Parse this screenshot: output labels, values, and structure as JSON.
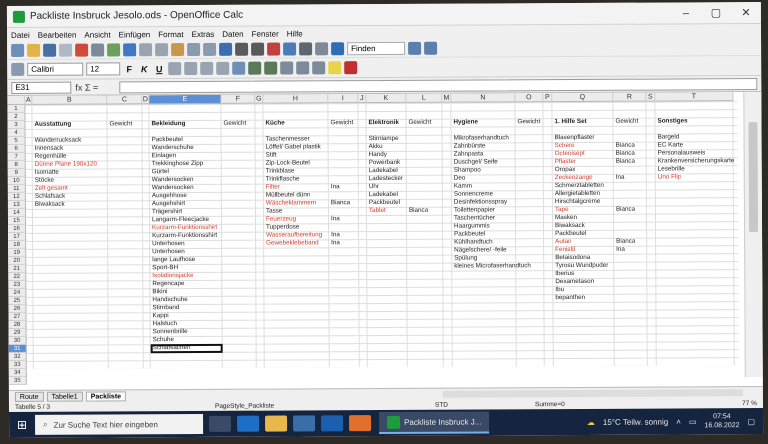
{
  "window": {
    "title": "Packliste Insbruck Jesolo.ods - OpenOffice Calc"
  },
  "menu": [
    "Datei",
    "Bearbeiten",
    "Ansicht",
    "Einfügen",
    "Format",
    "Extras",
    "Daten",
    "Fenster",
    "Hilfe"
  ],
  "toolbar": {
    "find_placeholder": "Finden"
  },
  "format": {
    "font": "Calibri",
    "size": "12"
  },
  "formula": {
    "cell_ref": "E31",
    "fx": "fx Σ ="
  },
  "columns": [
    "A",
    "B",
    "C",
    "D",
    "E",
    "F",
    "G",
    "H",
    "I",
    "J",
    "K",
    "L",
    "M",
    "N",
    "O",
    "P",
    "Q",
    "R",
    "S",
    "T"
  ],
  "selected_column": "E",
  "rows_count": 35,
  "selected_row": 31,
  "cells": [
    {
      "r": 3,
      "c": "B",
      "t": "Ausstattung",
      "b": true
    },
    {
      "r": 3,
      "c": "C",
      "t": "Gewicht"
    },
    {
      "r": 3,
      "c": "E",
      "t": "Bekleidung",
      "b": true
    },
    {
      "r": 3,
      "c": "F",
      "t": "Gewicht"
    },
    {
      "r": 3,
      "c": "H",
      "t": "Küche",
      "b": true
    },
    {
      "r": 3,
      "c": "I",
      "t": "Gewicht"
    },
    {
      "r": 3,
      "c": "K",
      "t": "Elektronik",
      "b": true
    },
    {
      "r": 3,
      "c": "L",
      "t": "Gewicht"
    },
    {
      "r": 3,
      "c": "N",
      "t": "Hygiene",
      "b": true
    },
    {
      "r": 3,
      "c": "O",
      "t": "Gewicht"
    },
    {
      "r": 3,
      "c": "Q",
      "t": "1. Hilfe Set",
      "b": true
    },
    {
      "r": 3,
      "c": "R",
      "t": "Gewicht"
    },
    {
      "r": 3,
      "c": "T",
      "t": "Sonstiges",
      "b": true
    },
    {
      "r": 5,
      "c": "B",
      "t": "Wanderrucksack"
    },
    {
      "r": 6,
      "c": "B",
      "t": "Innensack"
    },
    {
      "r": 7,
      "c": "B",
      "t": "Regenhülle"
    },
    {
      "r": 8,
      "c": "B",
      "t": "Dünne Plane 190x120",
      "red": true
    },
    {
      "r": 9,
      "c": "B",
      "t": "Isomatte"
    },
    {
      "r": 10,
      "c": "B",
      "t": "Stöcke"
    },
    {
      "r": 11,
      "c": "B",
      "t": "Zelt gesamt",
      "red": true
    },
    {
      "r": 12,
      "c": "B",
      "t": "Schlafsack"
    },
    {
      "r": 13,
      "c": "B",
      "t": "Biwaksack"
    },
    {
      "r": 5,
      "c": "E",
      "t": "Packbeutel"
    },
    {
      "r": 6,
      "c": "E",
      "t": "Wanderschuhe"
    },
    {
      "r": 7,
      "c": "E",
      "t": "Einlagen"
    },
    {
      "r": 8,
      "c": "E",
      "t": "Trekkinghose Zipp"
    },
    {
      "r": 9,
      "c": "E",
      "t": "Gürtel"
    },
    {
      "r": 10,
      "c": "E",
      "t": "Wandersocken"
    },
    {
      "r": 11,
      "c": "E",
      "t": "Wandersocken"
    },
    {
      "r": 12,
      "c": "E",
      "t": "Ausgehhose"
    },
    {
      "r": 13,
      "c": "E",
      "t": "Ausgehshirt"
    },
    {
      "r": 14,
      "c": "E",
      "t": "Trägershirt"
    },
    {
      "r": 15,
      "c": "E",
      "t": "Langarm-Fleecjacke"
    },
    {
      "r": 16,
      "c": "E",
      "t": "Kurzarm-Funktionsshirt",
      "red": true
    },
    {
      "r": 17,
      "c": "E",
      "t": "Kurzarm-Funktionsshirt"
    },
    {
      "r": 18,
      "c": "E",
      "t": "Unterhosen"
    },
    {
      "r": 19,
      "c": "E",
      "t": "Unterhosen"
    },
    {
      "r": 20,
      "c": "E",
      "t": "lange Laufhose"
    },
    {
      "r": 21,
      "c": "E",
      "t": "Sport-BH"
    },
    {
      "r": 22,
      "c": "E",
      "t": "Isolationsjacke",
      "red": true
    },
    {
      "r": 23,
      "c": "E",
      "t": "Regencape"
    },
    {
      "r": 24,
      "c": "E",
      "t": "Bikini"
    },
    {
      "r": 25,
      "c": "E",
      "t": "Handschuhe"
    },
    {
      "r": 26,
      "c": "E",
      "t": "Stirnband"
    },
    {
      "r": 27,
      "c": "E",
      "t": "Kappi"
    },
    {
      "r": 28,
      "c": "E",
      "t": "Halstuch"
    },
    {
      "r": 29,
      "c": "E",
      "t": "Sonnenbrille"
    },
    {
      "r": 30,
      "c": "E",
      "t": "Schuhe"
    },
    {
      "r": 31,
      "c": "E",
      "t": "Schlafsachen"
    },
    {
      "r": 5,
      "c": "H",
      "t": "Taschenmesser"
    },
    {
      "r": 6,
      "c": "H",
      "t": "Löffel/ Gabel plastik"
    },
    {
      "r": 7,
      "c": "H",
      "t": "Stift"
    },
    {
      "r": 8,
      "c": "H",
      "t": "Zip-Lock-Beutel"
    },
    {
      "r": 9,
      "c": "H",
      "t": "Trinkblase"
    },
    {
      "r": 10,
      "c": "H",
      "t": "Trinkflasche"
    },
    {
      "r": 11,
      "c": "H",
      "t": "Filter",
      "red": true
    },
    {
      "r": 11,
      "c": "I",
      "t": "Ina"
    },
    {
      "r": 12,
      "c": "H",
      "t": "Müllbeutel dünn"
    },
    {
      "r": 13,
      "c": "H",
      "t": "Wäscheklammern",
      "red": true
    },
    {
      "r": 13,
      "c": "I",
      "t": "Bianca"
    },
    {
      "r": 14,
      "c": "H",
      "t": "Tasse"
    },
    {
      "r": 15,
      "c": "H",
      "t": "Feuerzeug",
      "red": true
    },
    {
      "r": 15,
      "c": "I",
      "t": "Ina"
    },
    {
      "r": 16,
      "c": "H",
      "t": "Tupperdose"
    },
    {
      "r": 17,
      "c": "H",
      "t": "Wasseraufbereitung",
      "red": true
    },
    {
      "r": 17,
      "c": "I",
      "t": "Ina"
    },
    {
      "r": 18,
      "c": "H",
      "t": "Gewebeklebeband",
      "red": true
    },
    {
      "r": 18,
      "c": "I",
      "t": "Ina"
    },
    {
      "r": 5,
      "c": "K",
      "t": "Stirnlampe"
    },
    {
      "r": 6,
      "c": "K",
      "t": "Akku"
    },
    {
      "r": 7,
      "c": "K",
      "t": "Handy"
    },
    {
      "r": 8,
      "c": "K",
      "t": "Powerbank"
    },
    {
      "r": 9,
      "c": "K",
      "t": "Ladekabel"
    },
    {
      "r": 10,
      "c": "K",
      "t": "Ladestecker"
    },
    {
      "r": 11,
      "c": "K",
      "t": "Uhr"
    },
    {
      "r": 12,
      "c": "K",
      "t": "Ladekabel"
    },
    {
      "r": 13,
      "c": "K",
      "t": "Packbeutel"
    },
    {
      "r": 14,
      "c": "K",
      "t": "Tablet",
      "red": true
    },
    {
      "r": 14,
      "c": "L",
      "t": "Bianca"
    },
    {
      "r": 5,
      "c": "N",
      "t": "Mikrofaserhandtuch"
    },
    {
      "r": 6,
      "c": "N",
      "t": "Zahnbürste"
    },
    {
      "r": 7,
      "c": "N",
      "t": "Zahnpasta"
    },
    {
      "r": 8,
      "c": "N",
      "t": "Duschgel/ Seife"
    },
    {
      "r": 9,
      "c": "N",
      "t": "Shampoo"
    },
    {
      "r": 10,
      "c": "N",
      "t": "Deo"
    },
    {
      "r": 11,
      "c": "N",
      "t": "Kamm"
    },
    {
      "r": 12,
      "c": "N",
      "t": "Sonnencreme"
    },
    {
      "r": 13,
      "c": "N",
      "t": "Desinfektionsspray"
    },
    {
      "r": 14,
      "c": "N",
      "t": "Toilettenpapier"
    },
    {
      "r": 15,
      "c": "N",
      "t": "Taschentücher"
    },
    {
      "r": 16,
      "c": "N",
      "t": "Haargummis"
    },
    {
      "r": 17,
      "c": "N",
      "t": "Packbeutel"
    },
    {
      "r": 18,
      "c": "N",
      "t": "Kühlhandtuch"
    },
    {
      "r": 19,
      "c": "N",
      "t": "Nägelschere/ -feile"
    },
    {
      "r": 20,
      "c": "N",
      "t": "Spülung"
    },
    {
      "r": 21,
      "c": "N",
      "t": "kleines Microfaserhandtuch"
    },
    {
      "r": 5,
      "c": "Q",
      "t": "Blasenpflaster"
    },
    {
      "r": 6,
      "c": "Q",
      "t": "Schere",
      "red": true
    },
    {
      "r": 6,
      "c": "R",
      "t": "Bianca"
    },
    {
      "r": 7,
      "c": "Q",
      "t": "Octenisept",
      "red": true
    },
    {
      "r": 7,
      "c": "R",
      "t": "Bianca"
    },
    {
      "r": 8,
      "c": "Q",
      "t": "Pflaster",
      "red": true
    },
    {
      "r": 8,
      "c": "R",
      "t": "Bianca"
    },
    {
      "r": 9,
      "c": "Q",
      "t": "Oropax"
    },
    {
      "r": 10,
      "c": "Q",
      "t": "Zeckenzange",
      "red": true
    },
    {
      "r": 10,
      "c": "R",
      "t": "Ina"
    },
    {
      "r": 11,
      "c": "Q",
      "t": "Schmerztabletten"
    },
    {
      "r": 12,
      "c": "Q",
      "t": "Allergietabletten"
    },
    {
      "r": 13,
      "c": "Q",
      "t": "Hirschtalgcreme"
    },
    {
      "r": 14,
      "c": "Q",
      "t": "Tape",
      "red": true
    },
    {
      "r": 14,
      "c": "R",
      "t": "Bianca"
    },
    {
      "r": 15,
      "c": "Q",
      "t": "Masken"
    },
    {
      "r": 16,
      "c": "Q",
      "t": "Biwaksack"
    },
    {
      "r": 17,
      "c": "Q",
      "t": "Packbeutel"
    },
    {
      "r": 18,
      "c": "Q",
      "t": "Autan",
      "red": true
    },
    {
      "r": 18,
      "c": "R",
      "t": "Bianca"
    },
    {
      "r": 19,
      "c": "Q",
      "t": "Fenistil",
      "red": true
    },
    {
      "r": 19,
      "c": "R",
      "t": "Ina"
    },
    {
      "r": 20,
      "c": "Q",
      "t": "Betaisodona"
    },
    {
      "r": 21,
      "c": "Q",
      "t": "Tyrosu Wundpuder"
    },
    {
      "r": 22,
      "c": "Q",
      "t": "Iberius"
    },
    {
      "r": 23,
      "c": "Q",
      "t": "Dexametason"
    },
    {
      "r": 24,
      "c": "Q",
      "t": "Ibu"
    },
    {
      "r": 25,
      "c": "Q",
      "t": "bepanthen"
    },
    {
      "r": 5,
      "c": "T",
      "t": "Bargeld"
    },
    {
      "r": 6,
      "c": "T",
      "t": "EC Karte"
    },
    {
      "r": 7,
      "c": "T",
      "t": "Personalausweis"
    },
    {
      "r": 8,
      "c": "T",
      "t": "Krankenversicherungskarte"
    },
    {
      "r": 9,
      "c": "T",
      "t": "Lesebrille"
    },
    {
      "r": 10,
      "c": "T",
      "t": "Uno Flip",
      "red": true
    }
  ],
  "sheet_tabs": [
    "Route",
    "Tabelle1",
    "Packliste"
  ],
  "active_tab": "Packliste",
  "status": {
    "sheet": "Tabelle 5 / 3",
    "page_style": "PageStyle_Packliste",
    "mode": "STD",
    "sum": "Summe=0",
    "zoom": "77 %"
  },
  "taskbar": {
    "search_placeholder": "Zur Suche Text hier eingeben",
    "active_app": "Packliste Insbruck J...",
    "weather": "15°C  Teilw. sonnig",
    "time": "07:54",
    "date": "16.08.2022"
  },
  "colors": {
    "accent": "#5b8fd6",
    "red_text": "#d23b2c",
    "taskbar": "#16253f"
  }
}
